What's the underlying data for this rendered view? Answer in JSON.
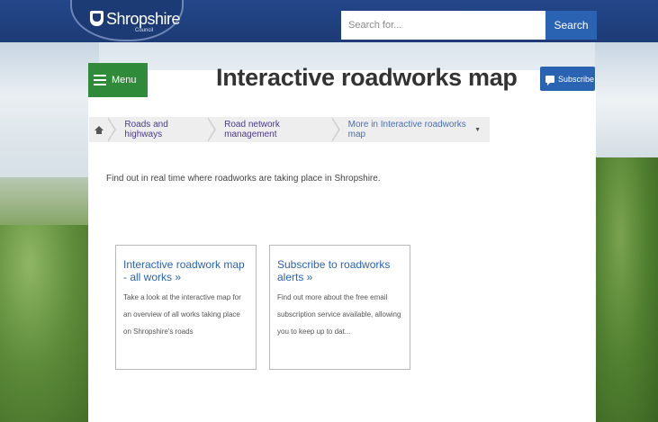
{
  "header": {
    "logo_text": "Shropshire",
    "logo_sub": "Council",
    "search_placeholder": "Search for...",
    "search_button": "Search"
  },
  "toolbar": {
    "menu_label": "Menu",
    "subscribe_label": "Subscribe"
  },
  "page": {
    "title": "Interactive roadworks map",
    "intro": "Find out in real time where roadworks are taking place in Shropshire."
  },
  "breadcrumb": {
    "items": [
      {
        "label": "Roads and highways"
      },
      {
        "label": "Road network management"
      },
      {
        "label": "More in Interactive roadworks map"
      }
    ]
  },
  "cards": [
    {
      "title": "Interactive roadwork map - all works »",
      "description": "Take a look at the interactive map for an overview of all works taking place on Shropshire's roads"
    },
    {
      "title": "Subscribe to roadworks alerts »",
      "description": "Find out more about the free email subscription service available, allowing you to keep up to dat..."
    }
  ],
  "colors": {
    "header_bg": "#1d3b75",
    "menu_green": "#2f8a3a",
    "accent_blue": "#2b63b3"
  }
}
